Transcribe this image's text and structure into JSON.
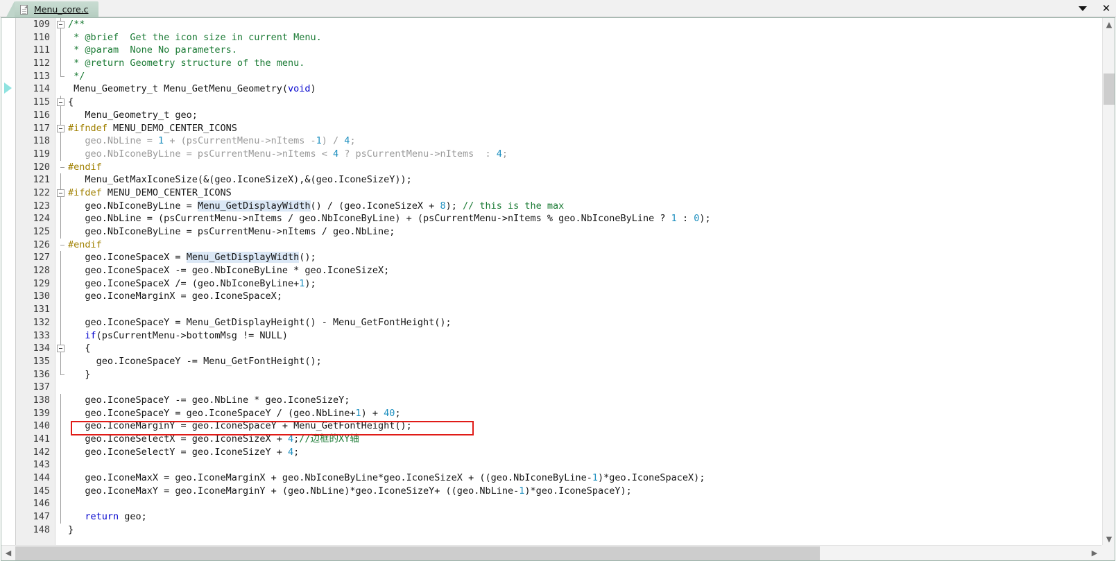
{
  "window": {
    "tab_label": "Menu_core.c",
    "doc_icon": "document-icon",
    "dropdown_icon": "chevron-down-icon",
    "close_icon": "close-icon"
  },
  "colors": {
    "tab_bg": "#bfd5ca",
    "annotation_red": "#e01b17",
    "keyword_blue": "#0000cd",
    "comment_green": "#1a7a34",
    "preprocessor_gold": "#a08000",
    "number_cyan": "#1d8fbf",
    "inactive_grey": "#999999",
    "occurrence_highlight": "#dbe8f6",
    "gutter_bg": "#efefef"
  },
  "editor": {
    "first_line": 109,
    "last_line": 148,
    "bookmark_line": 114,
    "annotated_line": 139,
    "annotation_shape": "red-rectangle",
    "vscroll_up_icon": "chevron-up-icon",
    "vscroll_down_icon": "chevron-down-icon",
    "hscroll_left_icon": "chevron-left-icon",
    "hscroll_right_icon": "chevron-right-icon"
  },
  "lines": [
    {
      "n": "109",
      "fold": "box",
      "html": "<span class=\"cmt\">/**</span>"
    },
    {
      "n": "110",
      "fold": "line",
      "html": "<span class=\"cmt\"> * @brief  Get the icon size in current Menu.</span>"
    },
    {
      "n": "111",
      "fold": "line",
      "html": "<span class=\"cmt\"> * @param  None No parameters.</span>"
    },
    {
      "n": "112",
      "fold": "line",
      "html": "<span class=\"cmt\"> * @return Geometry structure of the menu.</span>"
    },
    {
      "n": "113",
      "fold": "end",
      "html": "<span class=\"cmt\"> */</span>"
    },
    {
      "n": "114",
      "fold": "",
      "html": "<span class=\"txt\"> Menu_Geometry_t Menu_GetMenu_Geometry(</span><span class=\"kw\">void</span><span class=\"txt\">)</span>"
    },
    {
      "n": "115",
      "fold": "box",
      "html": "<span class=\"txt\">{</span>"
    },
    {
      "n": "116",
      "fold": "line",
      "html": "<span class=\"txt\">   Menu_Geometry_t geo;</span>"
    },
    {
      "n": "117",
      "fold": "box",
      "html": "<span class=\"pp\">#ifndef</span><span class=\"txt\"> MENU_DEMO_CENTER_ICONS</span>"
    },
    {
      "n": "118",
      "fold": "line",
      "html": "<span class=\"dim\">   geo.NbLine = </span><span class=\"num\">1</span><span class=\"dim\"> + (psCurrentMenu-&gt;nItems -</span><span class=\"num\">1</span><span class=\"dim\">) / </span><span class=\"num\">4</span><span class=\"dim\">;</span>"
    },
    {
      "n": "119",
      "fold": "line",
      "html": "<span class=\"dim\">   geo.NbIconeByLine = psCurrentMenu-&gt;nItems &lt; </span><span class=\"num\">4</span><span class=\"dim\"> ? psCurrentMenu-&gt;nItems  : </span><span class=\"num\">4</span><span class=\"dim\">;</span>"
    },
    {
      "n": "120",
      "fold": "tick",
      "html": "<span class=\"pp\">#endif</span>"
    },
    {
      "n": "121",
      "fold": "line",
      "html": "<span class=\"txt\">   Menu_GetMaxIconeSize(&amp;(geo.IconeSizeX),&amp;(geo.IconeSizeY));</span>"
    },
    {
      "n": "122",
      "fold": "box",
      "html": "<span class=\"pp\">#ifdef</span><span class=\"txt\"> MENU_DEMO_CENTER_ICONS</span>"
    },
    {
      "n": "123",
      "fold": "line",
      "html": "<span class=\"txt\">   geo.NbIconeByLine = </span><span class=\"txt hl\">Menu_GetDisplayWidth</span><span class=\"txt\">() / (geo.IconeSizeX + </span><span class=\"num\">8</span><span class=\"txt\">); </span><span class=\"cmt\">// this is the max</span>"
    },
    {
      "n": "124",
      "fold": "line",
      "html": "<span class=\"txt\">   geo.NbLine = (psCurrentMenu-&gt;nItems / geo.NbIconeByLine) + (psCurrentMenu-&gt;nItems % geo.NbIconeByLine ? </span><span class=\"num\">1</span><span class=\"txt\"> : </span><span class=\"num\">0</span><span class=\"txt\">);</span>"
    },
    {
      "n": "125",
      "fold": "line",
      "html": "<span class=\"txt\">   geo.NbIconeByLine = psCurrentMenu-&gt;nItems / geo.NbLine;</span>"
    },
    {
      "n": "126",
      "fold": "tick",
      "html": "<span class=\"pp\">#endif</span>"
    },
    {
      "n": "127",
      "fold": "line",
      "html": "<span class=\"txt\">   geo.IconeSpaceX = </span><span class=\"txt hl\">Menu_GetDisplayWidth</span><span class=\"txt\">();</span>"
    },
    {
      "n": "128",
      "fold": "line",
      "html": "<span class=\"txt\">   geo.IconeSpaceX -= geo.NbIconeByLine * geo.IconeSizeX;</span>"
    },
    {
      "n": "129",
      "fold": "line",
      "html": "<span class=\"txt\">   geo.IconeSpaceX /= (geo.NbIconeByLine+</span><span class=\"num\">1</span><span class=\"txt\">);</span>"
    },
    {
      "n": "130",
      "fold": "line",
      "html": "<span class=\"txt\">   geo.IconeMarginX = geo.IconeSpaceX;</span>"
    },
    {
      "n": "131",
      "fold": "line",
      "html": ""
    },
    {
      "n": "132",
      "fold": "line",
      "html": "<span class=\"txt\">   geo.IconeSpaceY = Menu_GetDisplayHeight() - Menu_GetFontHeight();</span>"
    },
    {
      "n": "133",
      "fold": "line",
      "html": "<span class=\"kw\">   if</span><span class=\"txt\">(psCurrentMenu-&gt;bottomMsg != NULL)</span>"
    },
    {
      "n": "134",
      "fold": "box",
      "html": "<span class=\"txt\">   {</span>"
    },
    {
      "n": "135",
      "fold": "line",
      "html": "<span class=\"txt\">     geo.IconeSpaceY -= Menu_GetFontHeight();</span>"
    },
    {
      "n": "136",
      "fold": "end",
      "html": "<span class=\"txt\">   }</span>"
    },
    {
      "n": "137",
      "fold": "",
      "html": ""
    },
    {
      "n": "138",
      "fold": "line",
      "html": "<span class=\"txt\">   geo.IconeSpaceY -= geo.NbLine * geo.IconeSizeY;</span>"
    },
    {
      "n": "139",
      "fold": "line",
      "html": "<span class=\"txt\">   geo.IconeSpaceY = geo.IconeSpaceY / (geo.NbLine+</span><span class=\"num\">1</span><span class=\"txt\">) + </span><span class=\"num\">40</span><span class=\"txt\">;</span>"
    },
    {
      "n": "140",
      "fold": "line",
      "html": "<span class=\"txt\">   geo.IconeMarginY = geo.IconeSpaceY + Menu_GetFontHeight();</span>"
    },
    {
      "n": "141",
      "fold": "line",
      "html": "<span class=\"txt\">   geo.IconeSelectX = geo.IconeSizeX + </span><span class=\"num\">4</span><span class=\"txt\">;</span><span class=\"cmt\">//边框的XY轴</span>"
    },
    {
      "n": "142",
      "fold": "line",
      "html": "<span class=\"txt\">   geo.IconeSelectY = geo.IconeSizeY + </span><span class=\"num\">4</span><span class=\"txt\">;</span>"
    },
    {
      "n": "143",
      "fold": "line",
      "html": ""
    },
    {
      "n": "144",
      "fold": "line",
      "html": "<span class=\"txt\">   geo.IconeMaxX = geo.IconeMarginX + geo.NbIconeByLine*geo.IconeSizeX + ((geo.NbIconeByLine-</span><span class=\"num\">1</span><span class=\"txt\">)*geo.IconeSpaceX);</span>"
    },
    {
      "n": "145",
      "fold": "line",
      "html": "<span class=\"txt\">   geo.IconeMaxY = geo.IconeMarginY + (geo.NbLine)*geo.IconeSizeY+ ((geo.NbLine-</span><span class=\"num\">1</span><span class=\"txt\">)*geo.IconeSpaceY);</span>"
    },
    {
      "n": "146",
      "fold": "line",
      "html": ""
    },
    {
      "n": "147",
      "fold": "line",
      "html": "<span class=\"kw\">   return</span><span class=\"txt\"> geo;</span>"
    },
    {
      "n": "148",
      "fold": "",
      "html": "<span class=\"txt\">}</span>"
    }
  ]
}
